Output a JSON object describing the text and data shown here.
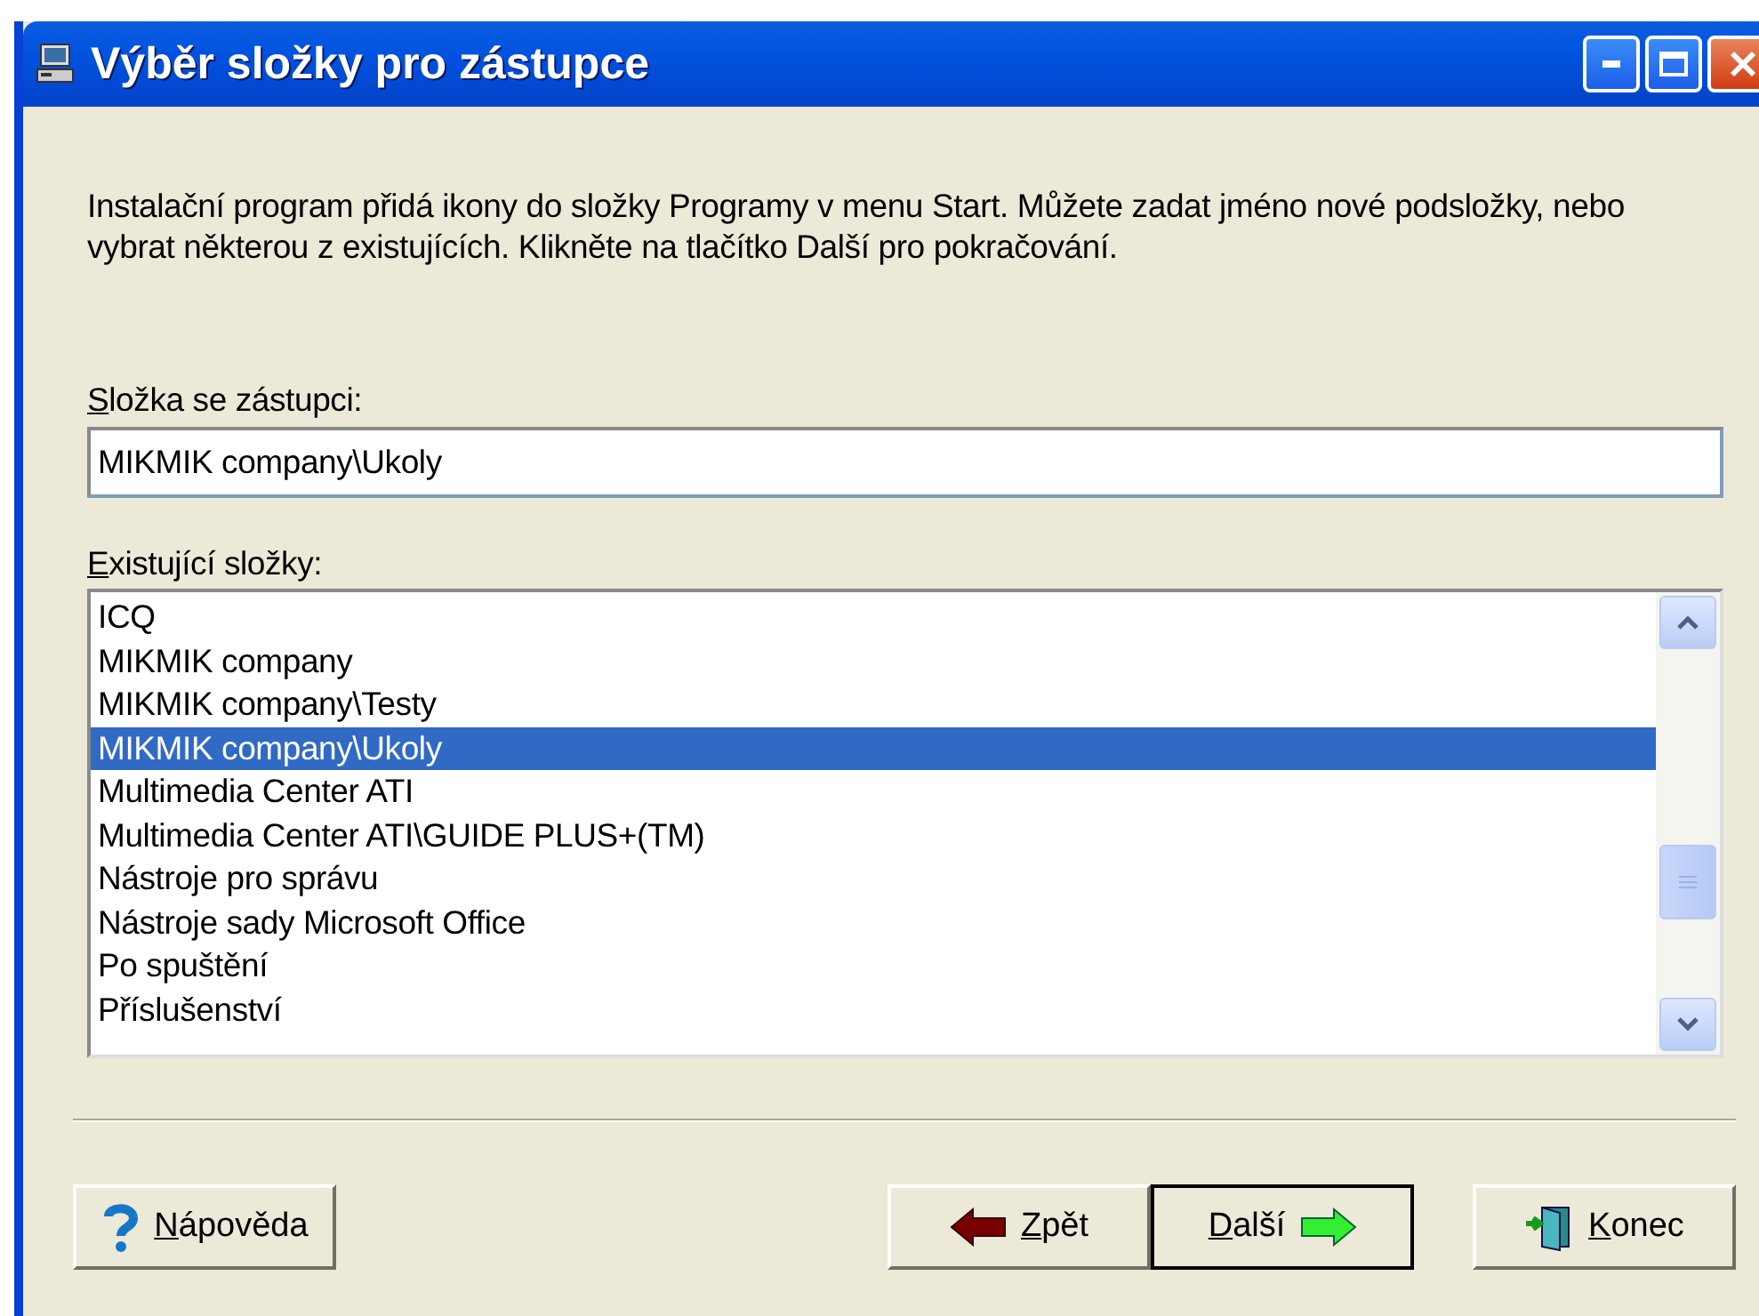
{
  "window": {
    "title": "Výběr složky pro zástupce"
  },
  "intro": "Instalační program přidá ikony do složky Programy v menu Start. Můžete zadat jméno nové podsložky, nebo vybrat některou z existujících. Klikněte na tlačítko Další pro pokračování.",
  "folder_field": {
    "label": "Složka se zástupci:",
    "value": "MIKMIK company\\Ukoly"
  },
  "folder_list": {
    "label": "Existující složky:",
    "items": [
      {
        "text": "ICQ",
        "selected": false
      },
      {
        "text": "MIKMIK company",
        "selected": false
      },
      {
        "text": "MIKMIK company\\Testy",
        "selected": false
      },
      {
        "text": "MIKMIK company\\Ukoly",
        "selected": true
      },
      {
        "text": "Multimedia Center ATI",
        "selected": false
      },
      {
        "text": "Multimedia Center ATI\\GUIDE PLUS+(TM)",
        "selected": false
      },
      {
        "text": "Nástroje pro správu",
        "selected": false
      },
      {
        "text": "Nástroje sady Microsoft Office",
        "selected": false
      },
      {
        "text": "Po spuštění",
        "selected": false
      },
      {
        "text": "Příslušenství",
        "selected": false
      }
    ]
  },
  "buttons": [
    {
      "kind": "help",
      "label": "Nápověda",
      "default": false
    },
    {
      "kind": "back",
      "label": "Zpět",
      "default": false
    },
    {
      "kind": "next",
      "label": "Další",
      "default": true
    },
    {
      "kind": "exit",
      "label": "Konec",
      "default": false
    }
  ]
}
